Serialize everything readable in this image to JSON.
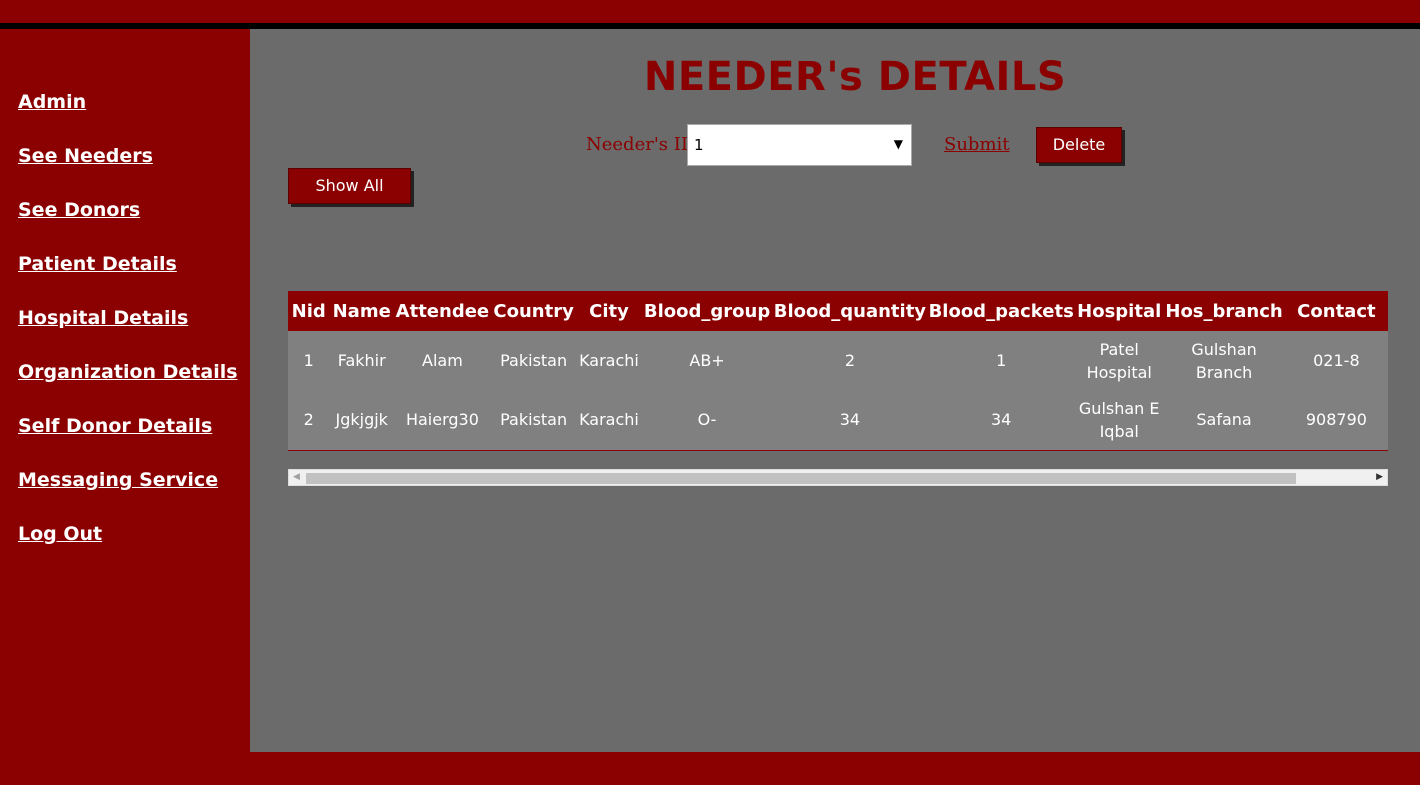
{
  "sidebar": {
    "items": [
      {
        "label": "Admin"
      },
      {
        "label": "See Needers"
      },
      {
        "label": "See Donors"
      },
      {
        "label": "Patient Details"
      },
      {
        "label": "Hospital Details"
      },
      {
        "label": "Organization Details"
      },
      {
        "label": "Self Donor Details"
      },
      {
        "label": "Messaging Service"
      },
      {
        "label": "Log Out"
      }
    ]
  },
  "main": {
    "title": "NEEDER's DETAILS",
    "id_label": "Needer's ID",
    "id_select_value": "1",
    "submit_label": "Submit",
    "delete_label": "Delete",
    "show_all_label": "Show All"
  },
  "table": {
    "columns": [
      "Nid",
      "Name",
      "Attendee",
      "Country",
      "City",
      "Blood_group",
      "Blood_quantity",
      "Blood_packets",
      "Hospital",
      "Hos_branch",
      "Contact"
    ],
    "rows": [
      [
        "1",
        "Fakhir",
        "Alam",
        "Pakistan",
        "Karachi",
        "AB+",
        "2",
        "1",
        "Patel Hospital",
        "Gulshan Branch",
        "021-8"
      ],
      [
        "2",
        "Jgkjgjk",
        "Haierg30",
        "Pakistan",
        "Karachi",
        "O-",
        "34",
        "34",
        "Gulshan E Iqbal",
        "Safana",
        "908790"
      ]
    ]
  },
  "colors": {
    "primary": "#8b0000",
    "content_bg": "#6b6b6b",
    "table_body_bg": "#808080"
  }
}
